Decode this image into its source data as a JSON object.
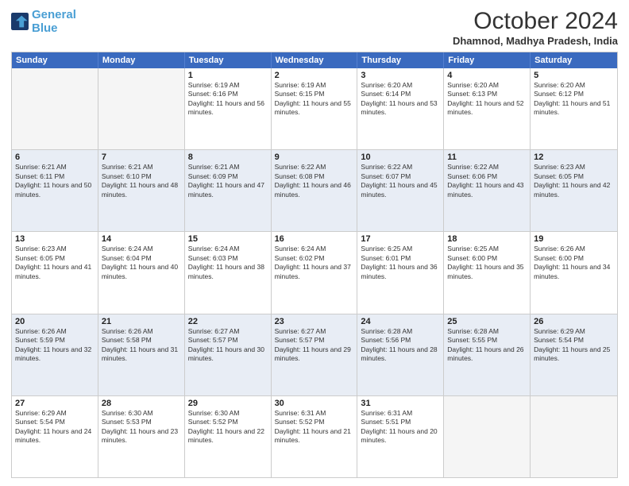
{
  "logo": {
    "line1": "General",
    "line2": "Blue"
  },
  "title": "October 2024",
  "subtitle": "Dhamnod, Madhya Pradesh, India",
  "header_days": [
    "Sunday",
    "Monday",
    "Tuesday",
    "Wednesday",
    "Thursday",
    "Friday",
    "Saturday"
  ],
  "weeks": [
    [
      {
        "day": "",
        "info": ""
      },
      {
        "day": "",
        "info": ""
      },
      {
        "day": "1",
        "info": "Sunrise: 6:19 AM\nSunset: 6:16 PM\nDaylight: 11 hours and 56 minutes."
      },
      {
        "day": "2",
        "info": "Sunrise: 6:19 AM\nSunset: 6:15 PM\nDaylight: 11 hours and 55 minutes."
      },
      {
        "day": "3",
        "info": "Sunrise: 6:20 AM\nSunset: 6:14 PM\nDaylight: 11 hours and 53 minutes."
      },
      {
        "day": "4",
        "info": "Sunrise: 6:20 AM\nSunset: 6:13 PM\nDaylight: 11 hours and 52 minutes."
      },
      {
        "day": "5",
        "info": "Sunrise: 6:20 AM\nSunset: 6:12 PM\nDaylight: 11 hours and 51 minutes."
      }
    ],
    [
      {
        "day": "6",
        "info": "Sunrise: 6:21 AM\nSunset: 6:11 PM\nDaylight: 11 hours and 50 minutes."
      },
      {
        "day": "7",
        "info": "Sunrise: 6:21 AM\nSunset: 6:10 PM\nDaylight: 11 hours and 48 minutes."
      },
      {
        "day": "8",
        "info": "Sunrise: 6:21 AM\nSunset: 6:09 PM\nDaylight: 11 hours and 47 minutes."
      },
      {
        "day": "9",
        "info": "Sunrise: 6:22 AM\nSunset: 6:08 PM\nDaylight: 11 hours and 46 minutes."
      },
      {
        "day": "10",
        "info": "Sunrise: 6:22 AM\nSunset: 6:07 PM\nDaylight: 11 hours and 45 minutes."
      },
      {
        "day": "11",
        "info": "Sunrise: 6:22 AM\nSunset: 6:06 PM\nDaylight: 11 hours and 43 minutes."
      },
      {
        "day": "12",
        "info": "Sunrise: 6:23 AM\nSunset: 6:05 PM\nDaylight: 11 hours and 42 minutes."
      }
    ],
    [
      {
        "day": "13",
        "info": "Sunrise: 6:23 AM\nSunset: 6:05 PM\nDaylight: 11 hours and 41 minutes."
      },
      {
        "day": "14",
        "info": "Sunrise: 6:24 AM\nSunset: 6:04 PM\nDaylight: 11 hours and 40 minutes."
      },
      {
        "day": "15",
        "info": "Sunrise: 6:24 AM\nSunset: 6:03 PM\nDaylight: 11 hours and 38 minutes."
      },
      {
        "day": "16",
        "info": "Sunrise: 6:24 AM\nSunset: 6:02 PM\nDaylight: 11 hours and 37 minutes."
      },
      {
        "day": "17",
        "info": "Sunrise: 6:25 AM\nSunset: 6:01 PM\nDaylight: 11 hours and 36 minutes."
      },
      {
        "day": "18",
        "info": "Sunrise: 6:25 AM\nSunset: 6:00 PM\nDaylight: 11 hours and 35 minutes."
      },
      {
        "day": "19",
        "info": "Sunrise: 6:26 AM\nSunset: 6:00 PM\nDaylight: 11 hours and 34 minutes."
      }
    ],
    [
      {
        "day": "20",
        "info": "Sunrise: 6:26 AM\nSunset: 5:59 PM\nDaylight: 11 hours and 32 minutes."
      },
      {
        "day": "21",
        "info": "Sunrise: 6:26 AM\nSunset: 5:58 PM\nDaylight: 11 hours and 31 minutes."
      },
      {
        "day": "22",
        "info": "Sunrise: 6:27 AM\nSunset: 5:57 PM\nDaylight: 11 hours and 30 minutes."
      },
      {
        "day": "23",
        "info": "Sunrise: 6:27 AM\nSunset: 5:57 PM\nDaylight: 11 hours and 29 minutes."
      },
      {
        "day": "24",
        "info": "Sunrise: 6:28 AM\nSunset: 5:56 PM\nDaylight: 11 hours and 28 minutes."
      },
      {
        "day": "25",
        "info": "Sunrise: 6:28 AM\nSunset: 5:55 PM\nDaylight: 11 hours and 26 minutes."
      },
      {
        "day": "26",
        "info": "Sunrise: 6:29 AM\nSunset: 5:54 PM\nDaylight: 11 hours and 25 minutes."
      }
    ],
    [
      {
        "day": "27",
        "info": "Sunrise: 6:29 AM\nSunset: 5:54 PM\nDaylight: 11 hours and 24 minutes."
      },
      {
        "day": "28",
        "info": "Sunrise: 6:30 AM\nSunset: 5:53 PM\nDaylight: 11 hours and 23 minutes."
      },
      {
        "day": "29",
        "info": "Sunrise: 6:30 AM\nSunset: 5:52 PM\nDaylight: 11 hours and 22 minutes."
      },
      {
        "day": "30",
        "info": "Sunrise: 6:31 AM\nSunset: 5:52 PM\nDaylight: 11 hours and 21 minutes."
      },
      {
        "day": "31",
        "info": "Sunrise: 6:31 AM\nSunset: 5:51 PM\nDaylight: 11 hours and 20 minutes."
      },
      {
        "day": "",
        "info": ""
      },
      {
        "day": "",
        "info": ""
      }
    ]
  ]
}
